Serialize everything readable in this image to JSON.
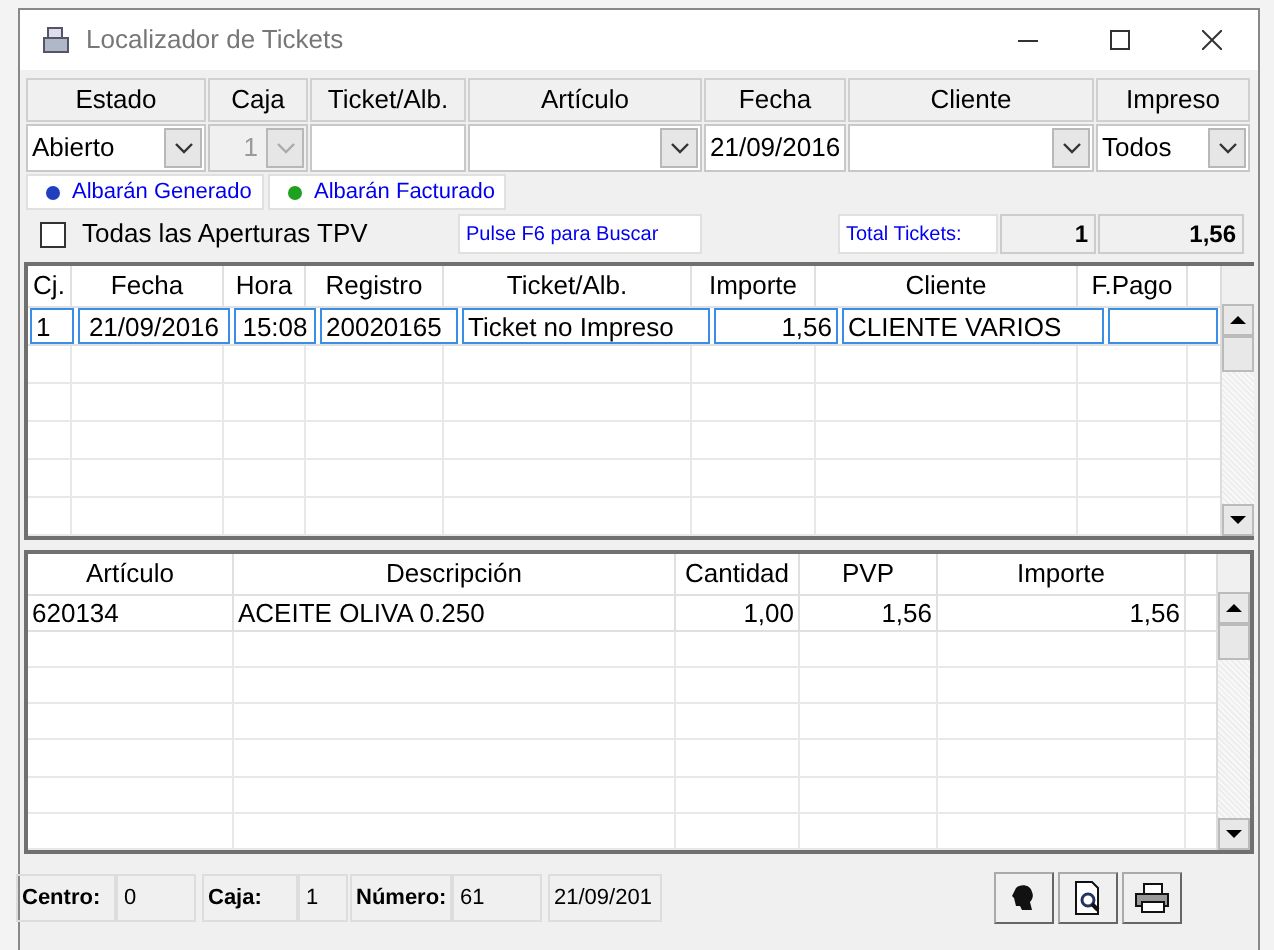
{
  "window": {
    "title": "Localizador de Tickets"
  },
  "filters": [
    {
      "label": "Estado",
      "kind": "select",
      "value": "Abierto",
      "disabled": false
    },
    {
      "label": "Caja",
      "kind": "select",
      "value": "1",
      "disabled": true
    },
    {
      "label": "Ticket/Alb.",
      "kind": "text",
      "disabled": false
    },
    {
      "label": "Artículo",
      "kind": "select",
      "disabled": false
    },
    {
      "label": "Fecha",
      "kind": "text",
      "value": "21/09/2016",
      "disabled": false
    },
    {
      "label": "Cliente",
      "kind": "select",
      "disabled": false
    },
    {
      "label": "Impreso",
      "kind": "select",
      "value": "Todos",
      "disabled": false
    }
  ],
  "legend": [
    {
      "label": "Albarán Generado",
      "color": "#1f3fbf"
    },
    {
      "label": "Albarán Facturado",
      "color": "#1fa01f"
    }
  ],
  "all_openings": {
    "label": "Todas las Aperturas TPV",
    "checked": false
  },
  "hint": "Pulse F6 para Buscar",
  "totals": {
    "label": "Total Tickets:",
    "count": "1",
    "amount": "1,56"
  },
  "tickets": {
    "columns": [
      "Cj.",
      "Fecha",
      "Hora",
      "Registro",
      "Ticket/Alb.",
      "Importe",
      "Cliente",
      "F.Pago"
    ],
    "rows": [
      {
        "cells": [
          "1",
          "21/09/2016",
          "15:08",
          "20020165",
          "Ticket no Impreso",
          "1,56",
          "CLIENTE VARIOS",
          null
        ],
        "selected": true
      }
    ]
  },
  "lines": {
    "columns": [
      "Artículo",
      "Descripción",
      "Cantidad",
      "PVP",
      "Importe"
    ],
    "rows": [
      {
        "cells": [
          "620134",
          "ACEITE OLIVA 0.250",
          "1,00",
          "1,56",
          "1,56"
        ]
      }
    ]
  },
  "status_bar": [
    {
      "label": "Centro:",
      "value": "0"
    },
    {
      "label": "Caja:",
      "value": "1"
    },
    {
      "label": "Número:",
      "value": "61"
    }
  ],
  "status_date": "21/09/201"
}
